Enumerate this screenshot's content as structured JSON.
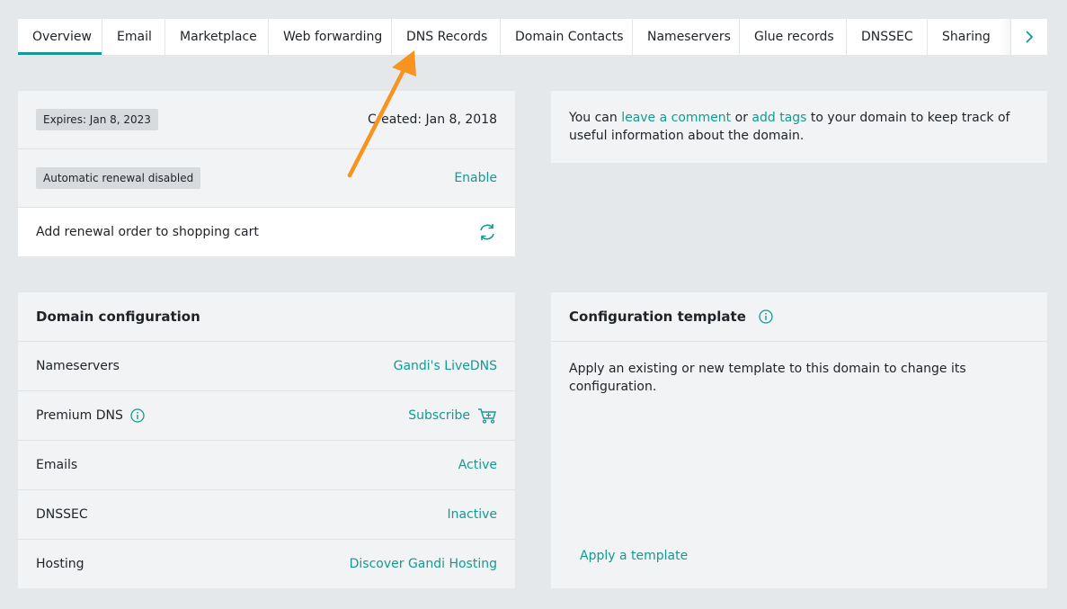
{
  "tabs": [
    {
      "label": "Overview"
    },
    {
      "label": "Email"
    },
    {
      "label": "Marketplace"
    },
    {
      "label": "Web forwarding"
    },
    {
      "label": "DNS Records"
    },
    {
      "label": "Domain Contacts"
    },
    {
      "label": "Nameservers"
    },
    {
      "label": "Glue records"
    },
    {
      "label": "DNSSEC"
    },
    {
      "label": "Sharing"
    }
  ],
  "renewal": {
    "expires": "Expires: Jan 8, 2023",
    "created": "Created: Jan 8, 2018",
    "auto_renew_badge": "Automatic renewal disabled",
    "enable_link": "Enable",
    "cart_label": "Add renewal order to shopping cart"
  },
  "notes": {
    "prefix": "You can ",
    "comment_link": "leave a comment",
    "or": " or ",
    "tags_link": "add tags",
    "suffix": " to your domain to keep track of useful information about the domain."
  },
  "config": {
    "title": "Domain configuration",
    "rows": [
      {
        "label": "Nameservers",
        "value": "Gandi's LiveDNS"
      },
      {
        "label": "Premium DNS",
        "value": "Subscribe"
      },
      {
        "label": "Emails",
        "value": "Active"
      },
      {
        "label": "DNSSEC",
        "value": "Inactive"
      },
      {
        "label": "Hosting",
        "value": "Discover Gandi Hosting"
      }
    ]
  },
  "template": {
    "title": "Configuration template",
    "description": "Apply an existing or new template to this domain to change its configuration.",
    "apply_link": "Apply a template"
  },
  "colors": {
    "accent": "#139b93",
    "annotation_arrow": "#f7931e",
    "background": "#e4e8ea"
  },
  "icons": {
    "tab_next": "chevron-right-icon",
    "renew": "refresh-icon",
    "info": "info-icon",
    "cart": "shopping-cart-icon"
  }
}
